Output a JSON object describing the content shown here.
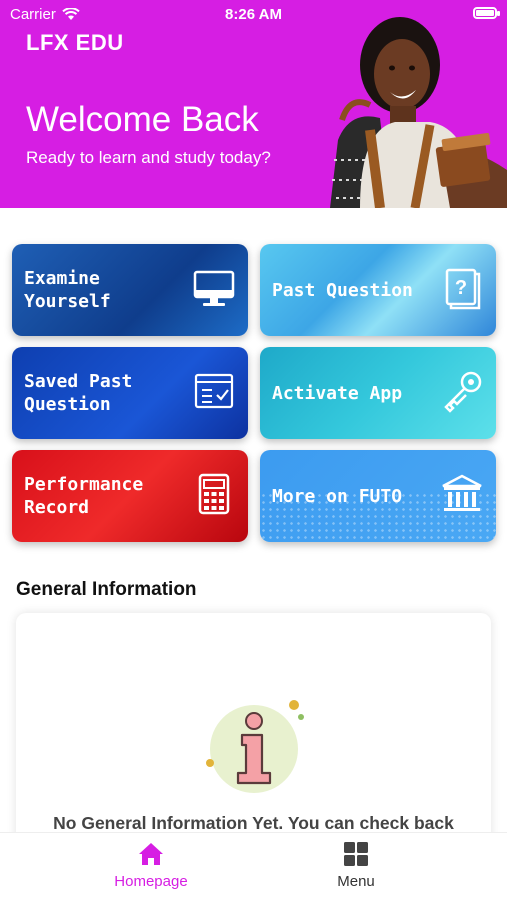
{
  "status_bar": {
    "carrier": "Carrier",
    "time": "8:26 AM"
  },
  "header": {
    "app_name": "LFX EDU",
    "welcome": "Welcome Back",
    "subtitle": "Ready to learn and study today?"
  },
  "tiles": [
    {
      "label": "Examine\nYourself",
      "icon": "monitor-icon"
    },
    {
      "label": "Past Question",
      "icon": "question-book-icon"
    },
    {
      "label": "Saved Past\nQuestion",
      "icon": "saved-list-icon"
    },
    {
      "label": "Activate App",
      "icon": "key-icon"
    },
    {
      "label": "Performance\nRecord",
      "icon": "calculator-icon"
    },
    {
      "label": "More on FUTO",
      "icon": "institution-icon"
    }
  ],
  "general_info": {
    "title": "General Information",
    "empty_text": "No General Information Yet. You can check back"
  },
  "tabbar": {
    "home_label": "Homepage",
    "menu_label": "Menu"
  },
  "colors": {
    "brand": "#d61ee3",
    "tab_active": "#d61ee3",
    "tab_inactive": "#333333"
  }
}
